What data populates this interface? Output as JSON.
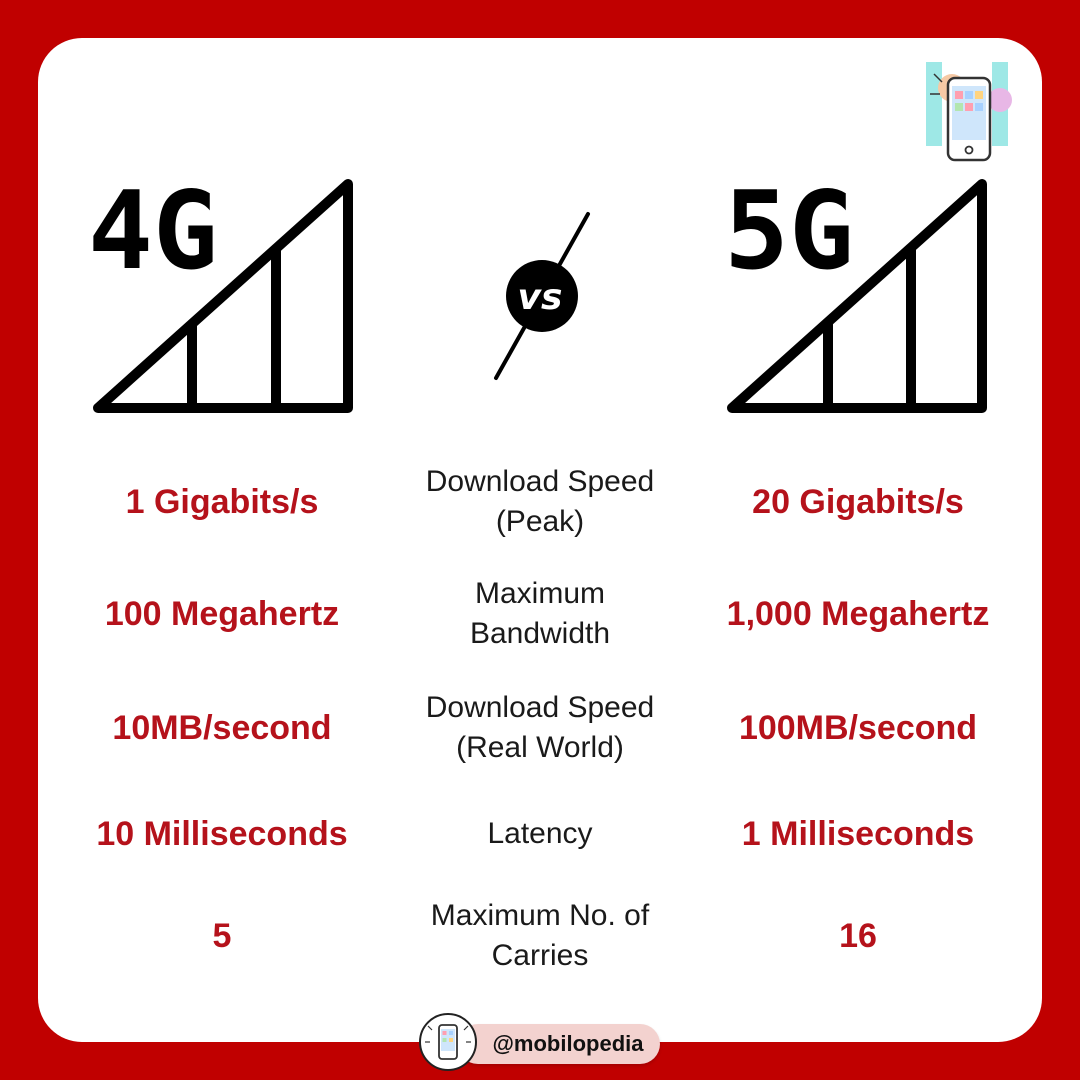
{
  "brand": {
    "logo_icon": "phone-logo-icon",
    "handle": "@mobilopedia",
    "accent_color": "#c00000",
    "value_color": "#b5121b"
  },
  "left_heading": "4G",
  "right_heading": "5G",
  "vs_text": "vs",
  "rows": [
    {
      "left": "1 Gigabits/s",
      "label_line1": "Download Speed",
      "label_line2": "(Peak)",
      "right": "20 Gigabits/s"
    },
    {
      "left": "100 Megahertz",
      "label_line1": "Maximum",
      "label_line2": "Bandwidth",
      "right": "1,000 Megahertz"
    },
    {
      "left": "10MB/second",
      "label_line1": "Download Speed",
      "label_line2": "(Real World)",
      "right": "100MB/second"
    },
    {
      "left": "10 Milliseconds",
      "label_line1": "Latency",
      "label_line2": "",
      "right": "1 Milliseconds"
    },
    {
      "left": "5",
      "label_line1": "Maximum No. of",
      "label_line2": "Carries",
      "right": "16"
    }
  ]
}
